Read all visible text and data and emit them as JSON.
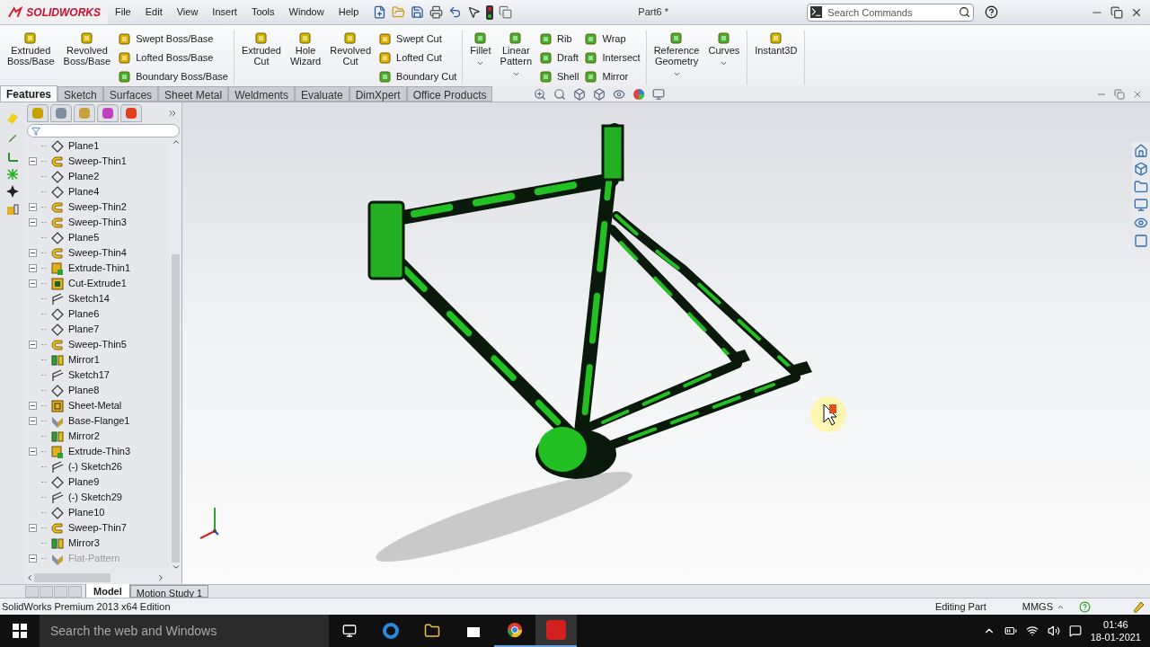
{
  "app": {
    "logo": "SOLIDWORKS",
    "menu": [
      "File",
      "Edit",
      "View",
      "Insert",
      "Tools",
      "Window",
      "Help"
    ],
    "document_title": "Part6 *",
    "search": {
      "placeholder": "Search Commands"
    }
  },
  "ribbon": {
    "groups": [
      {
        "items": [
          {
            "kind": "large",
            "label": "Extruded\nBoss/Base",
            "dropdown": false
          },
          {
            "kind": "large",
            "label": "Revolved\nBoss/Base",
            "dropdown": false
          },
          {
            "kind": "stack",
            "labels": [
              "Swept Boss/Base",
              "Lofted Boss/Base",
              "Boundary Boss/Base"
            ]
          }
        ]
      },
      {
        "items": [
          {
            "kind": "large",
            "label": "Extruded\nCut",
            "dropdown": false
          },
          {
            "kind": "large",
            "label": "Hole\nWizard",
            "dropdown": false
          },
          {
            "kind": "large",
            "label": "Revolved\nCut",
            "dropdown": false
          },
          {
            "kind": "stack",
            "labels": [
              "Swept Cut",
              "Lofted Cut",
              "Boundary Cut"
            ]
          }
        ]
      },
      {
        "items": [
          {
            "kind": "large",
            "label": "Fillet",
            "dropdown": true
          },
          {
            "kind": "large",
            "label": "Linear\nPattern",
            "dropdown": true
          },
          {
            "kind": "stack",
            "labels": [
              "Rib",
              "Draft",
              "Shell"
            ]
          },
          {
            "kind": "stack",
            "labels": [
              "Wrap",
              "Intersect",
              "Mirror"
            ]
          }
        ]
      },
      {
        "items": [
          {
            "kind": "large",
            "label": "Reference\nGeometry",
            "dropdown": true
          },
          {
            "kind": "large",
            "label": "Curves",
            "dropdown": true
          }
        ]
      },
      {
        "items": [
          {
            "kind": "large",
            "label": "Instant3D",
            "dropdown": false
          }
        ]
      }
    ]
  },
  "command_tabs": [
    {
      "label": "Features",
      "selected": true
    },
    {
      "label": "Sketch",
      "selected": false
    },
    {
      "label": "Surfaces",
      "selected": false
    },
    {
      "label": "Sheet Metal",
      "selected": false
    },
    {
      "label": "Weldments",
      "selected": false
    },
    {
      "label": "Evaluate",
      "selected": false
    },
    {
      "label": "DimXpert",
      "selected": false
    },
    {
      "label": "Office Products",
      "selected": false
    }
  ],
  "feature_tree": [
    {
      "name": "Plane1",
      "kind": "plane",
      "expandable": false,
      "disabled": false
    },
    {
      "name": "Sweep-Thin1",
      "kind": "sweep",
      "expandable": true,
      "disabled": false
    },
    {
      "name": "Plane2",
      "kind": "plane",
      "expandable": false,
      "disabled": false
    },
    {
      "name": "Plane4",
      "kind": "plane",
      "expandable": false,
      "disabled": false
    },
    {
      "name": "Sweep-Thin2",
      "kind": "sweep",
      "expandable": true,
      "disabled": false
    },
    {
      "name": "Sweep-Thin3",
      "kind": "sweep",
      "expandable": true,
      "disabled": false
    },
    {
      "name": "Plane5",
      "kind": "plane",
      "expandable": false,
      "disabled": false
    },
    {
      "name": "Sweep-Thin4",
      "kind": "sweep",
      "expandable": true,
      "disabled": false
    },
    {
      "name": "Extrude-Thin1",
      "kind": "extrude",
      "expandable": true,
      "disabled": false
    },
    {
      "name": "Cut-Extrude1",
      "kind": "cut",
      "expandable": true,
      "disabled": false
    },
    {
      "name": "Sketch14",
      "kind": "sketch",
      "expandable": false,
      "disabled": false
    },
    {
      "name": "Plane6",
      "kind": "plane",
      "expandable": false,
      "disabled": false
    },
    {
      "name": "Plane7",
      "kind": "plane",
      "expandable": false,
      "disabled": false
    },
    {
      "name": "Sweep-Thin5",
      "kind": "sweep",
      "expandable": true,
      "disabled": false
    },
    {
      "name": "Mirror1",
      "kind": "mirror",
      "expandable": false,
      "disabled": false
    },
    {
      "name": "Sketch17",
      "kind": "sketch",
      "expandable": false,
      "disabled": false
    },
    {
      "name": "Plane8",
      "kind": "plane",
      "expandable": false,
      "disabled": false
    },
    {
      "name": "Sheet-Metal",
      "kind": "sheetmetal",
      "expandable": true,
      "disabled": false
    },
    {
      "name": "Base-Flange1",
      "kind": "flange",
      "expandable": true,
      "disabled": false
    },
    {
      "name": "Mirror2",
      "kind": "mirror",
      "expandable": false,
      "disabled": false
    },
    {
      "name": "Extrude-Thin3",
      "kind": "extrude",
      "expandable": true,
      "disabled": false
    },
    {
      "name": "(-) Sketch26",
      "kind": "sketch",
      "expandable": false,
      "disabled": false
    },
    {
      "name": "Plane9",
      "kind": "plane",
      "expandable": false,
      "disabled": false
    },
    {
      "name": "(-) Sketch29",
      "kind": "sketch",
      "expandable": false,
      "disabled": false
    },
    {
      "name": "Plane10",
      "kind": "plane",
      "expandable": false,
      "disabled": false
    },
    {
      "name": "Sweep-Thin7",
      "kind": "sweep",
      "expandable": true,
      "disabled": false
    },
    {
      "name": "Mirror3",
      "kind": "mirror",
      "expandable": false,
      "disabled": false
    },
    {
      "name": "Flat-Pattern",
      "kind": "flange",
      "expandable": true,
      "disabled": true
    }
  ],
  "bottom_tabs": [
    {
      "label": "Model",
      "selected": true
    },
    {
      "label": "Motion Study 1",
      "selected": false
    }
  ],
  "status_bar": {
    "edition": "SolidWorks Premium 2013 x64 Edition",
    "mode": "Editing Part",
    "units": "MMGS"
  },
  "taskbar": {
    "search_placeholder": "Search the web and Windows",
    "time": "01:46",
    "date": "18-01-2021"
  }
}
